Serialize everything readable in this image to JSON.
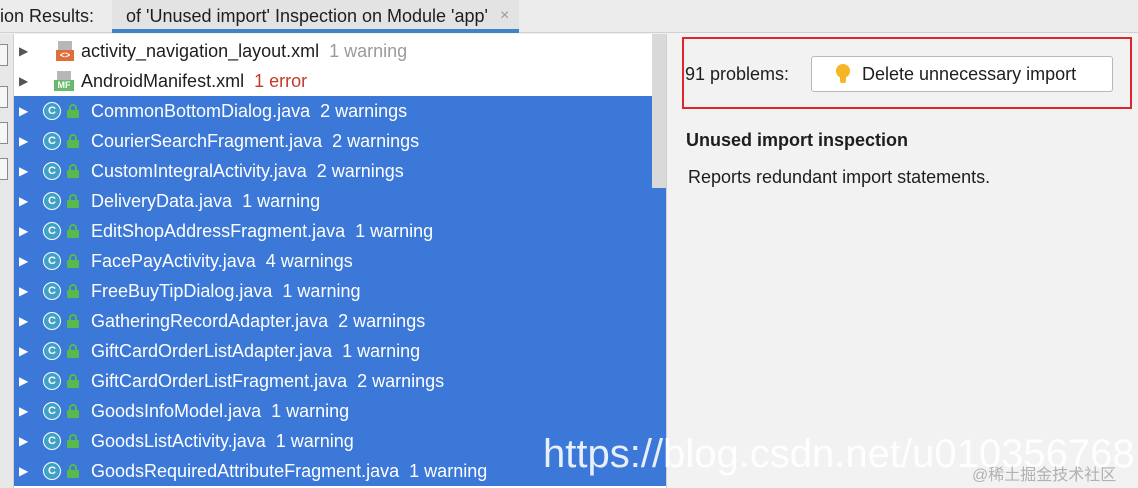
{
  "tabs": {
    "prefix_label": "ion Results:",
    "active_label": "of 'Unused import' Inspection on Module 'app'",
    "close_glyph": "×"
  },
  "tree": {
    "rows": [
      {
        "name": "activity_navigation_layout.xml",
        "count": "1 warning",
        "icon": "xml-file-icon",
        "selected": false
      },
      {
        "name": "AndroidManifest.xml",
        "count": "1 error",
        "icon": "manifest-file-icon",
        "selected": false,
        "error": true
      },
      {
        "name": "CommonBottomDialog.java",
        "count": "2 warnings",
        "icon": "java-class-icon",
        "selected": true
      },
      {
        "name": "CourierSearchFragment.java",
        "count": "2 warnings",
        "icon": "java-class-icon",
        "selected": true
      },
      {
        "name": "CustomIntegralActivity.java",
        "count": "2 warnings",
        "icon": "java-class-icon",
        "selected": true
      },
      {
        "name": "DeliveryData.java",
        "count": "1 warning",
        "icon": "java-class-icon",
        "selected": true
      },
      {
        "name": "EditShopAddressFragment.java",
        "count": "1 warning",
        "icon": "java-class-icon",
        "selected": true
      },
      {
        "name": "FacePayActivity.java",
        "count": "4 warnings",
        "icon": "java-class-icon",
        "selected": true
      },
      {
        "name": "FreeBuyTipDialog.java",
        "count": "1 warning",
        "icon": "java-class-icon",
        "selected": true
      },
      {
        "name": "GatheringRecordAdapter.java",
        "count": "2 warnings",
        "icon": "java-class-icon",
        "selected": true
      },
      {
        "name": "GiftCardOrderListAdapter.java",
        "count": "1 warning",
        "icon": "java-class-icon",
        "selected": true
      },
      {
        "name": "GiftCardOrderListFragment.java",
        "count": "2 warnings",
        "icon": "java-class-icon",
        "selected": true
      },
      {
        "name": "GoodsInfoModel.java",
        "count": "1 warning",
        "icon": "java-class-icon",
        "selected": true
      },
      {
        "name": "GoodsListActivity.java",
        "count": "1 warning",
        "icon": "java-class-icon",
        "selected": true
      },
      {
        "name": "GoodsRequiredAttributeFragment.java",
        "count": "1 warning",
        "icon": "java-class-icon",
        "selected": true
      }
    ],
    "class_icon_letter": "C",
    "xml_tag_text": "<>",
    "mf_tag_text": "MF"
  },
  "details": {
    "problems_label": "91 problems:",
    "action_button_label": "Delete unnecessary import",
    "inspection_title": "Unused import inspection",
    "inspection_description": "Reports redundant import statements."
  },
  "watermarks": {
    "url": "https://blog.csdn.net/u010356768",
    "credit": "@稀土掘金技术社区"
  },
  "colors": {
    "selection": "#3b78d8",
    "error": "#c23a2b",
    "highlight_box": "#e0262d",
    "tab_underline": "#4083c9"
  }
}
